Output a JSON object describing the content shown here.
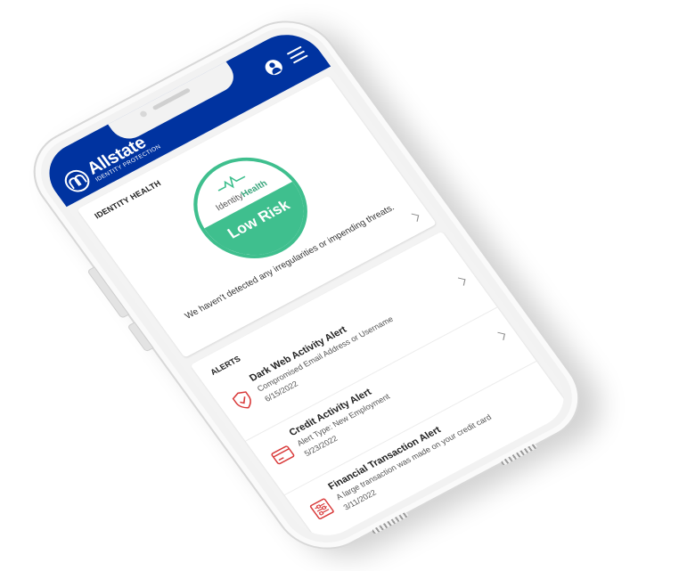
{
  "header": {
    "brand_name": "Allstate",
    "brand_subtitle": "IDENTITY PROTECTION",
    "bg_color": "#0033a0"
  },
  "health": {
    "title": "IDENTITY HEALTH",
    "badge_brand_prefix": "Identity",
    "badge_brand_suffix": "Health",
    "risk_level": "Low Risk",
    "message": "We haven't detected any irregularities or impending threats.",
    "accent_color": "#3fbf8e"
  },
  "alerts": {
    "title": "ALERTS",
    "items": [
      {
        "icon": "shield-alert-icon",
        "title": "Dark Web Activity Alert",
        "description": "Compromised Email Address or Username",
        "date": "6/15/2022"
      },
      {
        "icon": "credit-card-icon",
        "title": "Credit Activity Alert",
        "description": "Alert Type: New Employment",
        "date": "5/23/2022"
      },
      {
        "icon": "transaction-icon",
        "title": "Financial Transaction Alert",
        "description": "A large transaction was made on your credit card",
        "date": "3/11/2022"
      }
    ],
    "icon_color": "#d93a3a"
  }
}
